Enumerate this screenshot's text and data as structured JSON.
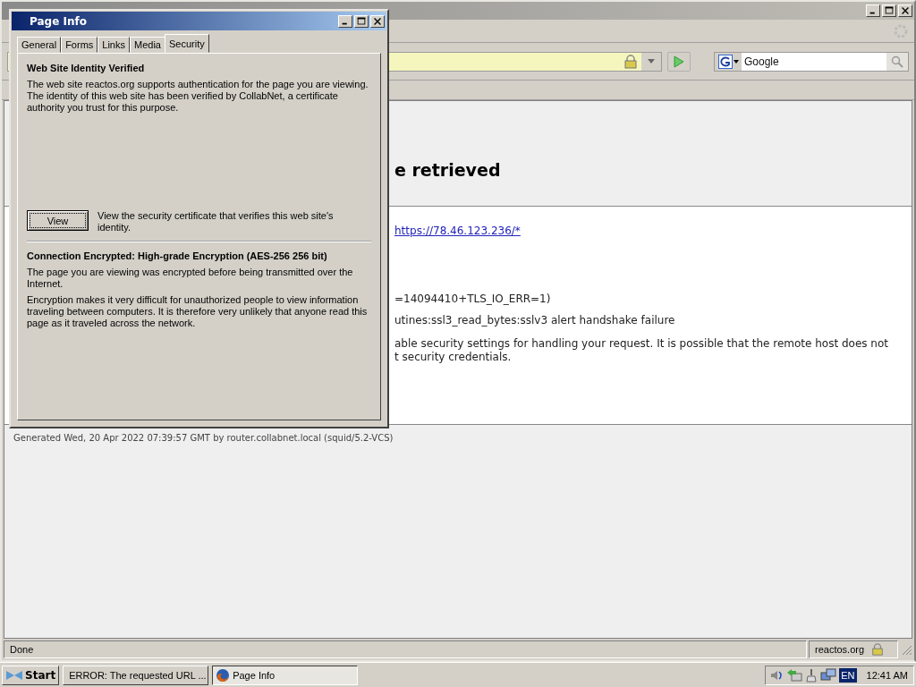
{
  "browser": {
    "address_bar": {
      "secure": true
    },
    "search": {
      "placeholder": "Google"
    }
  },
  "page": {
    "heading": "e retrieved",
    "link": "https://78.46.123.236/*",
    "lines": [
      "=14094410+TLS_IO_ERR=1)",
      "utines:ssl3_read_bytes:sslv3 alert handshake failure"
    ],
    "paragraph": [
      "able security settings for handling your request. It is possible that the remote host does not",
      "t security credentials."
    ],
    "footer": "Generated Wed, 20 Apr 2022 07:39:57 GMT by router.collabnet.local (squid/5.2-VCS)"
  },
  "status_bar": {
    "text": "Done",
    "domain": "reactos.org"
  },
  "dialog": {
    "title": "Page Info",
    "tabs": [
      {
        "label": "General",
        "selected": false
      },
      {
        "label": "Forms",
        "selected": false
      },
      {
        "label": "Links",
        "selected": false
      },
      {
        "label": "Media",
        "selected": false
      },
      {
        "label": "Security",
        "selected": true
      }
    ],
    "identity": {
      "heading": "Web Site Identity Verified",
      "text": "The web site reactos.org supports authentication for the page you are viewing. The identity of this web site has been verified by CollabNet, a certificate authority you trust for this purpose."
    },
    "view_button": "View",
    "view_hint": "View the security certificate that verifies this web site's identity.",
    "encryption": {
      "heading": "Connection Encrypted: High-grade Encryption (AES-256 256 bit)",
      "paragraphs": [
        "The page you are viewing was encrypted before being transmitted over the Internet.",
        "Encryption makes it very difficult for unauthorized people to view information traveling between computers. It is therefore very unlikely that anyone read this page as it traveled across the network."
      ]
    }
  },
  "taskbar": {
    "start": "Start",
    "tasks": [
      {
        "label": "ERROR: The requested URL ...",
        "selected": false
      },
      {
        "label": "Page Info",
        "selected": true
      }
    ],
    "language": "EN",
    "clock": "12:41 AM"
  }
}
